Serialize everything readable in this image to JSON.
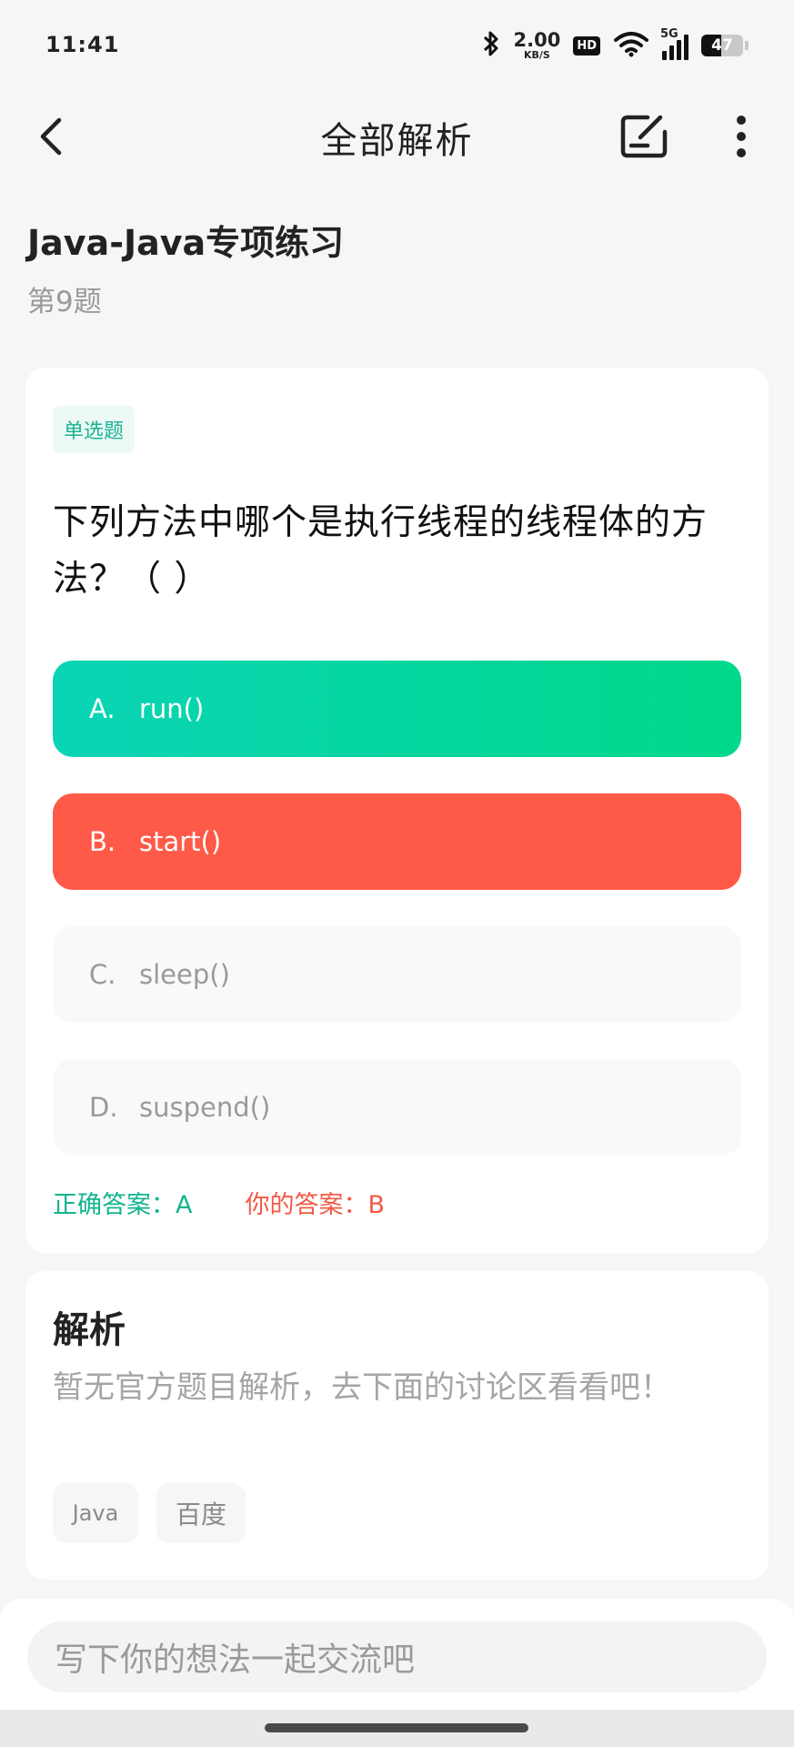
{
  "status_bar": {
    "time": "11:41",
    "net_speed_value": "2.00",
    "net_speed_unit": "KB/S",
    "hd_label": "HD",
    "network_label": "5G",
    "battery_level": "47",
    "icons": [
      "bluetooth-icon",
      "wifi-icon",
      "signal-icon",
      "battery-icon"
    ]
  },
  "header": {
    "title": "全部解析"
  },
  "practice": {
    "title": "Java-Java专项练习",
    "question_number": "第9题"
  },
  "question": {
    "type_tag": "单选题",
    "text": "下列方法中哪个是执行线程的线程体的方法？（ ）",
    "options": [
      {
        "letter": "A.",
        "text": "run()",
        "state": "correct"
      },
      {
        "letter": "B.",
        "text": "start()",
        "state": "wrong"
      },
      {
        "letter": "C.",
        "text": "sleep()",
        "state": "neutral"
      },
      {
        "letter": "D.",
        "text": "suspend()",
        "state": "neutral"
      }
    ],
    "correct_answer_label": "正确答案：A",
    "your_answer_label": "你的答案：B"
  },
  "analysis": {
    "title": "解析",
    "text": "暂无官方题目解析，去下面的讨论区看看吧！",
    "tags": [
      "Java",
      "百度"
    ]
  },
  "comment": {
    "placeholder": "写下你的想法一起交流吧"
  },
  "colors": {
    "correct": "#12b48e",
    "wrong": "#ff5a47",
    "accent_green_start": "#0bd4b6",
    "accent_green_end": "#00d88a"
  }
}
